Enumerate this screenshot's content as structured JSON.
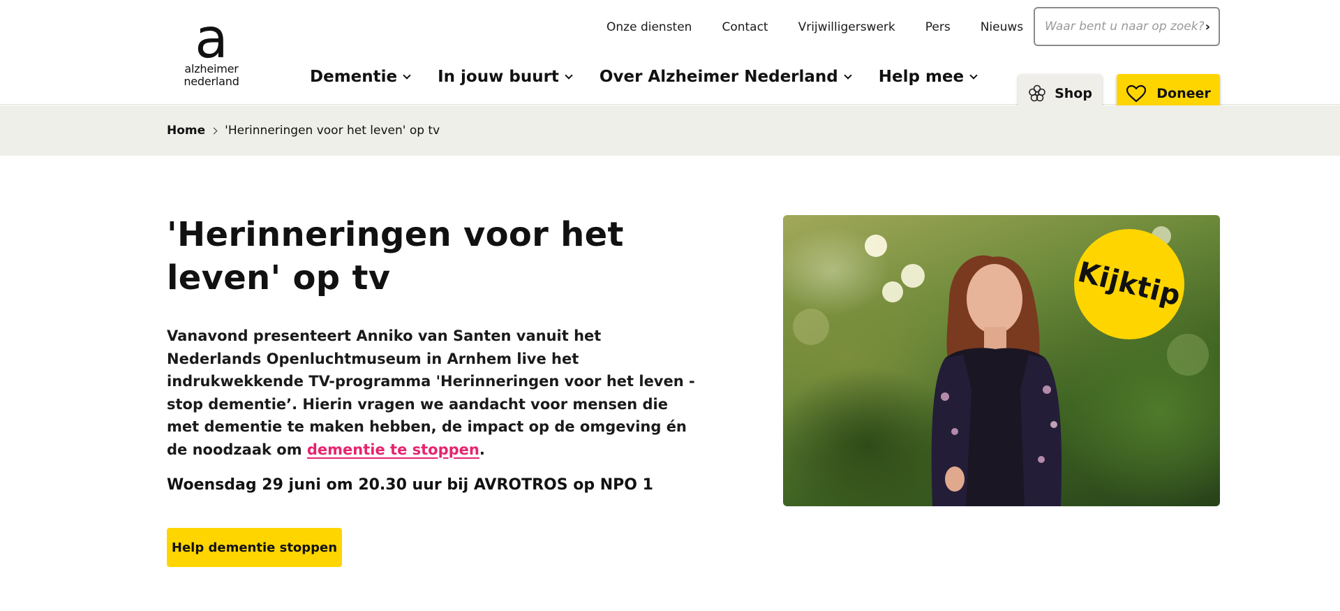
{
  "logo": {
    "mark": "a",
    "line1": "alzheimer",
    "line2": "nederland"
  },
  "topnav": [
    "Onze diensten",
    "Contact",
    "Vrijwilligerswerk",
    "Pers",
    "Nieuws"
  ],
  "search": {
    "placeholder": "Waar bent u naar op zoek?",
    "value": ""
  },
  "mainnav": [
    "Dementie",
    "In jouw buurt",
    "Over Alzheimer Nederland",
    "Help mee"
  ],
  "buttons": {
    "shop": "Shop",
    "doneer": "Doneer"
  },
  "breadcrumb": {
    "home": "Home",
    "current": "'Herinneringen voor het leven' op tv"
  },
  "article": {
    "title": "'Herinneringen voor het leven' op tv",
    "intro_text": "Vanavond presenteert Anniko van Santen vanuit het Nederlands Openluchtmuseum in Arnhem live het indrukwekkende TV-programma 'Herinneringen voor het leven - stop dementie’. Hierin vragen we aandacht voor mensen die met dementie te maken hebben, de impact op de omgeving én de noodzaak om ",
    "intro_link": "dementie te stoppen",
    "intro_end": ".",
    "date_line": "Woensdag 29 juni om 20.30 uur bij AVROTROS op NPO 1",
    "cta": "Help dementie stoppen"
  },
  "hero": {
    "badge": "Kijktip"
  },
  "colors": {
    "accent_yellow": "#ffd500",
    "link_pink": "#e6246e",
    "band_grey": "#efefe9"
  },
  "icons": {
    "shop": "flower-icon",
    "doneer": "heart-icon",
    "search": "chevron-right-icon",
    "nav": "chevron-down-icon"
  }
}
